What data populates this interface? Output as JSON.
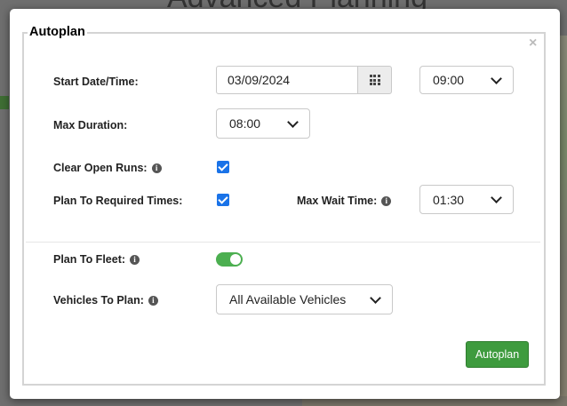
{
  "background": {
    "page_title": "Advanced Planning"
  },
  "dialog": {
    "legend": "Autoplan",
    "close_symbol": "×",
    "start_datetime": {
      "label": "Start Date/Time:",
      "date_value": "03/09/2024",
      "time_value": "09:00"
    },
    "max_duration": {
      "label": "Max Duration:",
      "value": "08:00"
    },
    "clear_open_runs": {
      "label": "Clear Open Runs:",
      "checked": true
    },
    "plan_to_required_times": {
      "label": "Plan To Required Times:",
      "checked": true
    },
    "max_wait_time": {
      "label": "Max Wait Time:",
      "value": "01:30"
    },
    "plan_to_fleet": {
      "label": "Plan To Fleet:",
      "enabled": true
    },
    "vehicles_to_plan": {
      "label": "Vehicles To Plan:",
      "value": "All Available Vehicles"
    },
    "submit_label": "Autoplan"
  },
  "colors": {
    "toggle_on": "#4caf50",
    "checkbox": "#1a73e8",
    "primary_button": "#3e9b3e"
  }
}
